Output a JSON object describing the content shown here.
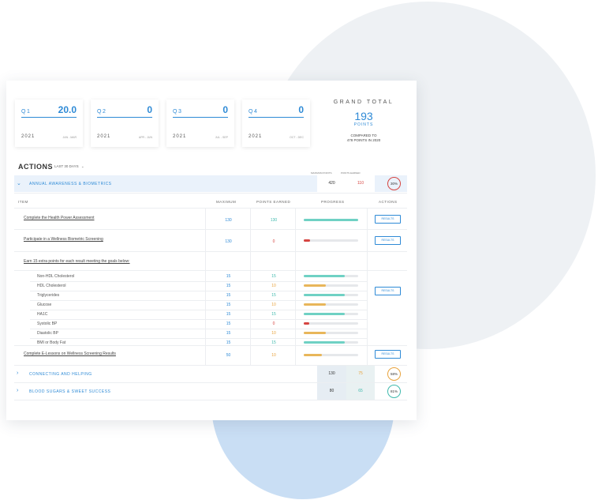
{
  "quarters": [
    {
      "label": "Q1",
      "value": "20.0",
      "year": "2021",
      "range": "JAN - MAR"
    },
    {
      "label": "Q2",
      "value": "0",
      "year": "2021",
      "range": "APR - JUN"
    },
    {
      "label": "Q3",
      "value": "0",
      "year": "2021",
      "range": "JUL - SEP"
    },
    {
      "label": "Q4",
      "value": "0",
      "year": "2021",
      "range": "OCT - DEC"
    }
  ],
  "grand_total": {
    "title": "GRAND TOTAL",
    "value": "193",
    "unit": "POINTS",
    "compared_line1": "COMPARED TO",
    "compared_line2": "478 POINTS IN 2020"
  },
  "actions": {
    "title": "ACTIONS",
    "filter": "LAST 30 DAYS"
  },
  "summary_headers": {
    "max": "MAXIMUM POINTS",
    "earned": "POINTS EARNED"
  },
  "sections": [
    {
      "label": "ANNUAL AWARENESS & BIOMETRICS",
      "max": "420",
      "earned": "110",
      "percent": "30%",
      "percent_fraction": 0.3,
      "earned_color": "#d64541",
      "ring_color": "#d64541"
    },
    {
      "label": "CONNECTING AND HELPING",
      "max": "130",
      "earned": "75",
      "percent": "58%",
      "percent_fraction": 0.58,
      "earned_color": "#e8a33d",
      "ring_color": "#e8a33d"
    },
    {
      "label": "BLOOD SUGARS & SWEET SUCCESS",
      "max": "80",
      "earned": "65",
      "percent": "81%",
      "percent_fraction": 0.81,
      "earned_color": "#3fb9ad",
      "ring_color": "#3fb9ad"
    }
  ],
  "table_headers": {
    "item": "ITEM",
    "maximum": "MAXIMUM",
    "earned": "POINTS EARNED",
    "progress": "PROGRESS",
    "actions": "ACTIONS"
  },
  "button_label": "RESULTS",
  "items": [
    {
      "name": "Complete the Health Power Assessment",
      "max": "130",
      "earned": "130",
      "progress": 1.0,
      "color": "#6fd1c4"
    },
    {
      "name": "Participate in a Wellness Biometric Screening",
      "max": "130",
      "earned": "0",
      "progress": 0.12,
      "color": "#d64541"
    }
  ],
  "note": "Earn 15 extra points for each result meeting the goals below:",
  "sub_items": [
    {
      "name": "Non-HDL Cholesterol",
      "max": "15",
      "earned": "15",
      "progress": 0.75,
      "color": "#6fd1c4"
    },
    {
      "name": "HDL Cholesterol",
      "max": "15",
      "earned": "10",
      "progress": 0.4,
      "color": "#e8b65a"
    },
    {
      "name": "Triglycerides",
      "max": "15",
      "earned": "15",
      "progress": 0.75,
      "color": "#6fd1c4"
    },
    {
      "name": "Glucose",
      "max": "15",
      "earned": "10",
      "progress": 0.4,
      "color": "#e8b65a"
    },
    {
      "name": "HA1C",
      "max": "15",
      "earned": "15",
      "progress": 0.75,
      "color": "#6fd1c4"
    },
    {
      "name": "Systolic BP",
      "max": "15",
      "earned": "0",
      "progress": 0.1,
      "color": "#d64541"
    },
    {
      "name": "Diastolic BP",
      "max": "15",
      "earned": "10",
      "progress": 0.4,
      "color": "#e8b65a"
    },
    {
      "name": "BMI or Body Fat",
      "max": "15",
      "earned": "15",
      "progress": 0.75,
      "color": "#6fd1c4"
    }
  ],
  "last_item": {
    "name": "Complete E-Lessons on Wellness Screening Results",
    "max": "50",
    "earned": "10",
    "progress": 0.33,
    "color": "#e8b65a"
  },
  "colors": {
    "accent": "#2e8ad6",
    "teal": "#6fd1c4",
    "amber": "#e8b65a",
    "red": "#d64541",
    "earned_teal": "#3fb9ad",
    "earned_amber": "#e8a33d"
  }
}
